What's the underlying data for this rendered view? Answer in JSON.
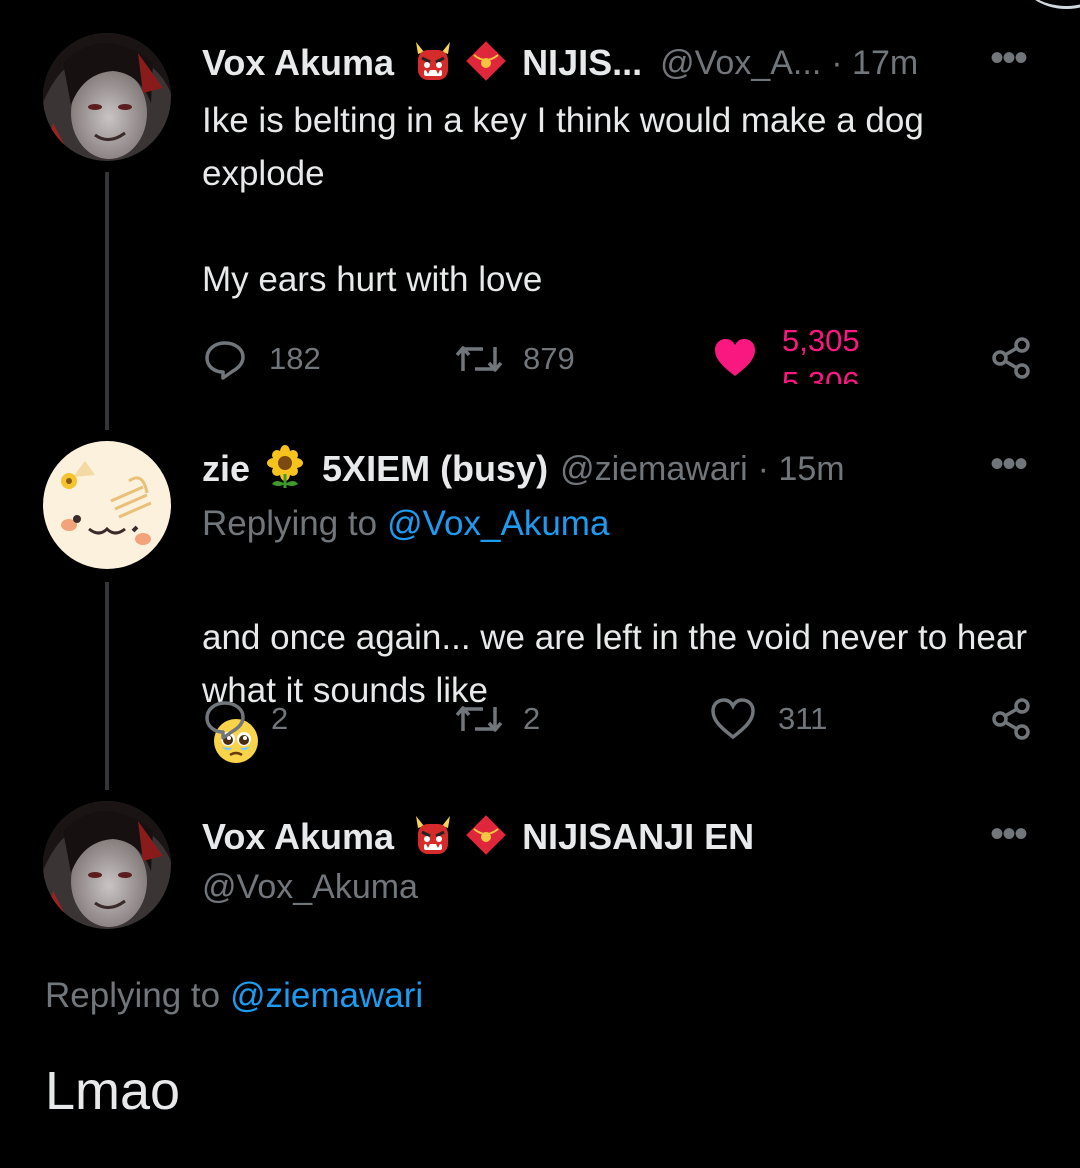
{
  "colors": {
    "background": "#000000",
    "text": "#e7e9ea",
    "muted": "#71767b",
    "link": "#1d9bf0",
    "like": "#f91880"
  },
  "tweet1": {
    "name": "Vox Akuma",
    "badge_icons": [
      "oni-mask-icon",
      "red-envelope-icon"
    ],
    "affiliation": "NIJIS...",
    "handle": "@Vox_A...",
    "time": "· 17m",
    "body": "Ike is belting in a key I think would make a dog explode\n\nMy ears hurt with love",
    "replies": "182",
    "retweets": "879",
    "likes": "5,305",
    "liked": true
  },
  "tweet2": {
    "name": "zie",
    "badge_icons": [
      "sunflower-icon"
    ],
    "affiliation": "5XIEM (busy)",
    "handle": "@ziemawari",
    "time": "· 15m",
    "replying_prefix": "Replying to",
    "replying_to": "@Vox_Akuma",
    "body": "and once again... we are left in the void never to hear what it sounds like",
    "emoji": "pleading-face-icon",
    "replies": "2",
    "retweets": "2",
    "likes": "311",
    "liked": false
  },
  "tweet3": {
    "name": "Vox Akuma",
    "badge_icons": [
      "oni-mask-icon",
      "red-envelope-icon"
    ],
    "affiliation": "NIJISANJI EN",
    "handle": "@Vox_Akuma",
    "replying_prefix": "Replying to",
    "replying_to": "@ziemawari",
    "body": "Lmao"
  }
}
